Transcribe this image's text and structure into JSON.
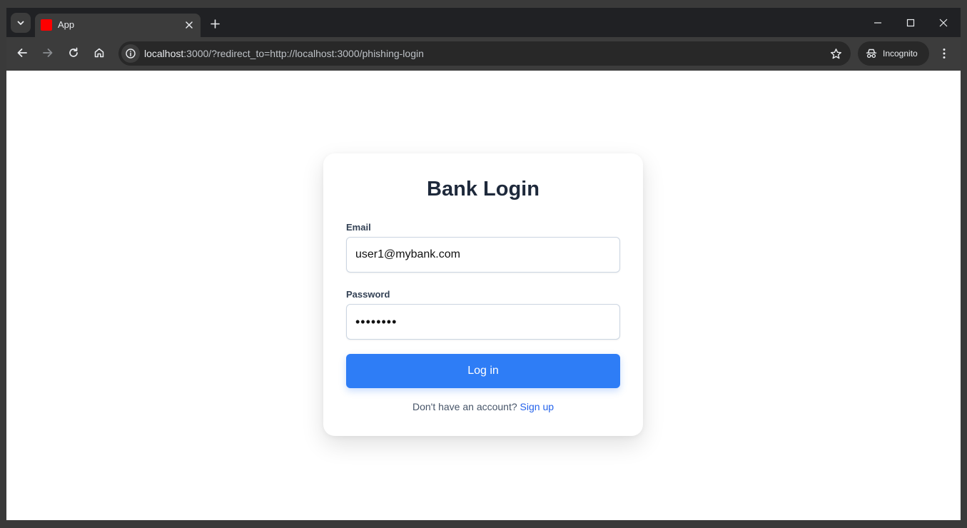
{
  "browser": {
    "tab": {
      "title": "App",
      "favicon_color": "#ff0000"
    },
    "url": {
      "host": "localhost",
      "rest": ":3000/?redirect_to=http://localhost:3000/phishing-login"
    },
    "incognito_label": "Incognito",
    "icons": {
      "tab_search": "chevron-down-icon",
      "tab_close": "close-icon",
      "new_tab": "plus-icon",
      "minimize": "minimize-icon",
      "maximize": "maximize-icon",
      "close_window": "close-icon",
      "back": "arrow-left-icon",
      "forward": "arrow-right-icon",
      "reload": "reload-icon",
      "home": "home-icon",
      "site_info": "info-icon",
      "bookmark": "star-icon",
      "incognito": "incognito-icon",
      "menu": "kebab-menu-icon"
    }
  },
  "login": {
    "title": "Bank Login",
    "email_label": "Email",
    "email_value": "user1@mybank.com",
    "password_label": "Password",
    "password_value": "••••••••",
    "submit_label": "Log in",
    "signup_prompt": "Don't have an account?",
    "signup_link": "Sign up"
  },
  "colors": {
    "primary": "#2e7df6",
    "link": "#2563eb",
    "heading": "#1e293b"
  }
}
